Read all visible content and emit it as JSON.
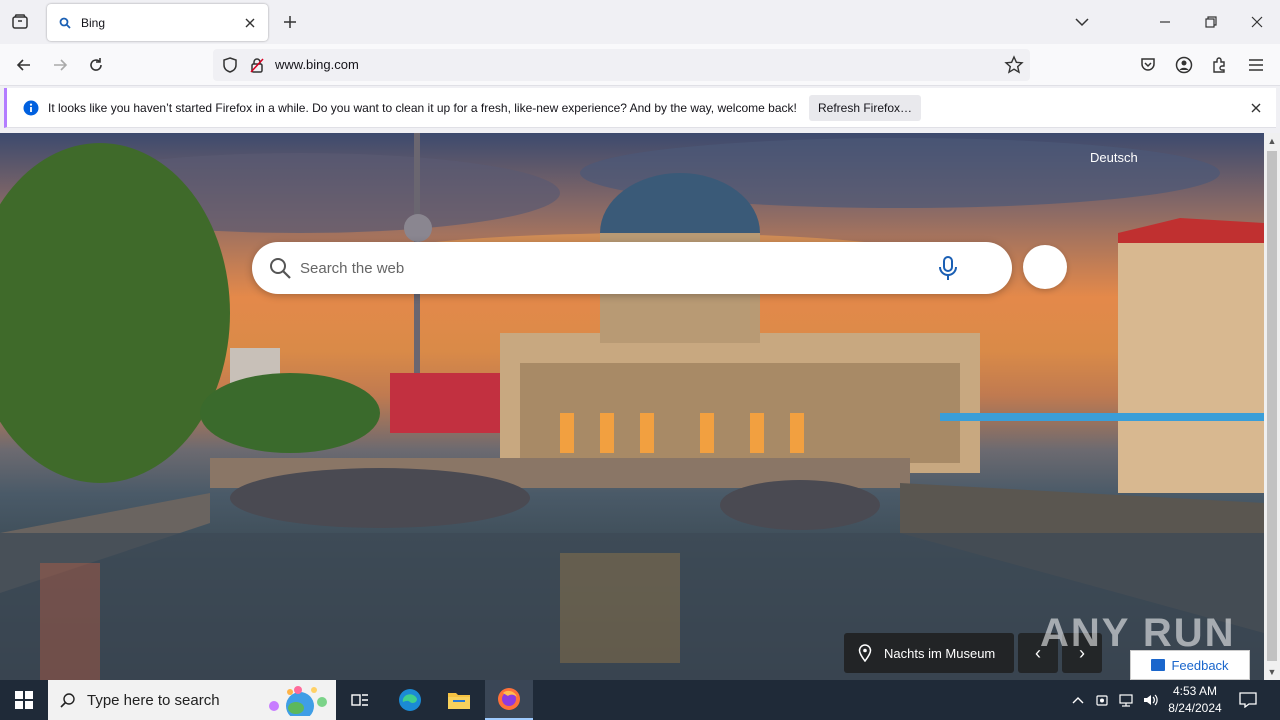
{
  "browser": {
    "tab": {
      "title": "Bing",
      "favicon": "search-icon"
    },
    "url": "www.bing.com",
    "notification": {
      "message": "It looks like you haven’t started Firefox in a while. Do you want to clean it up for a fresh, like-new experience? And by the way, welcome back!",
      "button_label": "Refresh Firefox…"
    }
  },
  "bing": {
    "language_link": "Deutsch",
    "search_placeholder": "Search the web",
    "image_caption": "Nachts im Museum",
    "feedback_label": "Feedback",
    "watermark": "ANY RUN"
  },
  "taskbar": {
    "search_placeholder": "Type here to search",
    "time": "4:53 AM",
    "date": "8/24/2024"
  }
}
